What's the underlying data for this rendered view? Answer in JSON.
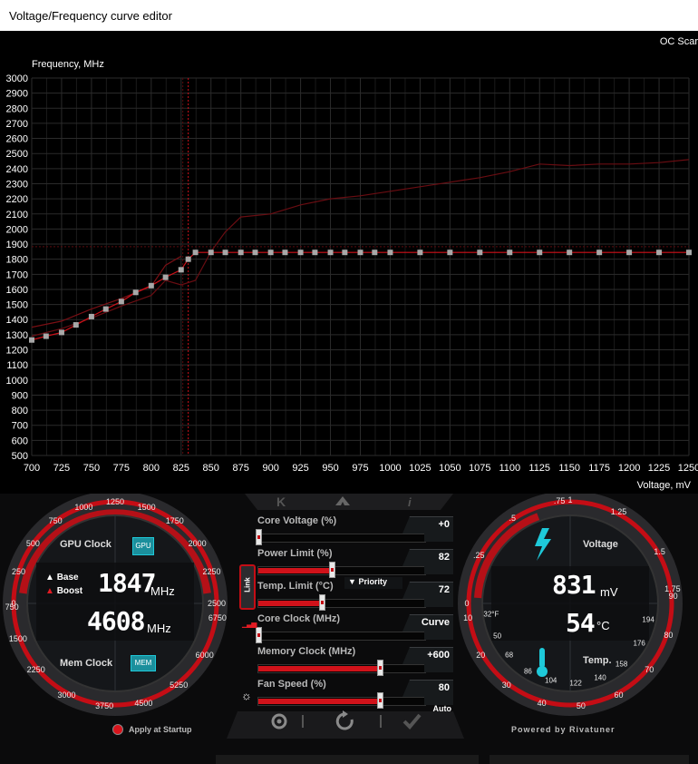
{
  "window": {
    "title": "Voltage/Frequency curve editor",
    "oc_scanner_label": "OC Scar"
  },
  "chart_data": {
    "type": "line",
    "ylabel": "Frequency, MHz",
    "xlabel": "Voltage, mV",
    "xlim": [
      700,
      1250
    ],
    "ylim": [
      500,
      3000
    ],
    "x_ticks": [
      700,
      725,
      750,
      775,
      800,
      825,
      850,
      875,
      900,
      925,
      950,
      975,
      1000,
      1025,
      1050,
      1075,
      1100,
      1125,
      1150,
      1175,
      1200,
      1225,
      1250
    ],
    "y_ticks": [
      500,
      600,
      700,
      800,
      900,
      1000,
      1100,
      1200,
      1300,
      1400,
      1500,
      1600,
      1700,
      1800,
      1900,
      2000,
      2100,
      2200,
      2300,
      2400,
      2500,
      2600,
      2700,
      2800,
      2900,
      3000
    ],
    "current_voltage_marker": 831,
    "frequency_cap": 1847,
    "series": [
      {
        "role": "curve_points",
        "x": [
          700,
          712,
          725,
          737,
          750,
          762,
          775,
          787,
          800,
          812,
          825,
          831,
          837,
          850,
          862,
          875,
          887,
          900,
          912,
          925,
          937,
          950,
          962,
          975,
          987,
          1000,
          1025,
          1050,
          1075,
          1100,
          1125,
          1150,
          1175,
          1200,
          1225,
          1250
        ],
        "y": [
          1265,
          1290,
          1315,
          1365,
          1420,
          1470,
          1520,
          1580,
          1625,
          1680,
          1730,
          1800,
          1845,
          1845,
          1845,
          1845,
          1845,
          1845,
          1845,
          1845,
          1845,
          1845,
          1845,
          1845,
          1845,
          1845,
          1845,
          1845,
          1845,
          1845,
          1845,
          1845,
          1845,
          1845,
          1845,
          1845
        ]
      },
      {
        "role": "default_curve",
        "x": [
          700,
          725,
          750,
          775,
          800,
          812,
          825,
          837,
          850,
          862,
          875,
          900,
          925,
          950,
          975,
          1000,
          1025,
          1050,
          1075,
          1100,
          1125,
          1150,
          1175,
          1200,
          1225,
          1250
        ],
        "y": [
          1290,
          1340,
          1410,
          1490,
          1560,
          1660,
          1630,
          1660,
          1850,
          1980,
          2080,
          2100,
          2160,
          2200,
          2220,
          2250,
          2280,
          2310,
          2340,
          2380,
          2430,
          2420,
          2430,
          2430,
          2440,
          2460
        ]
      },
      {
        "role": "upper_curve",
        "x": [
          700,
          725,
          750,
          775,
          800,
          812,
          825
        ],
        "y": [
          1350,
          1390,
          1470,
          1540,
          1620,
          1760,
          1820
        ]
      }
    ]
  },
  "controls": {
    "core_voltage": {
      "label": "Core Voltage (%)",
      "value": "+0",
      "fraction": 0
    },
    "power_limit": {
      "label": "Power Limit (%)",
      "value": "82",
      "fraction": 0.44
    },
    "temp_limit": {
      "label": "Temp. Limit (°C)",
      "value": "72",
      "fraction": 0.38
    },
    "core_clock": {
      "label": "Core Clock (MHz)",
      "value": "Curve",
      "fraction": 0
    },
    "memory_clock": {
      "label": "Memory Clock (MHz)",
      "value": "+600",
      "fraction": 0.73
    },
    "fan_speed": {
      "label": "Fan Speed (%)",
      "value": "80",
      "fraction": 0.73,
      "mode": "Auto"
    },
    "link_label": "Link",
    "priority_label": "Priority"
  },
  "left_gauge": {
    "gpu_clock_label": "GPU Clock",
    "mem_clock_label": "Mem Clock",
    "gpu_chip": "GPU",
    "mem_chip": "MEM",
    "base_label": "Base",
    "boost_label": "Boost",
    "core_value": "1847",
    "core_unit": "MHz",
    "mem_value": "4608",
    "mem_unit": "MHz",
    "outer_scale": [
      "0",
      "250",
      "500",
      "750",
      "1000",
      "1250",
      "1500",
      "1750",
      "2000",
      "2250",
      "2500"
    ],
    "inner_scale": [
      "750",
      "1500",
      "2250",
      "3000",
      "3750",
      "4500",
      "5250",
      "6000",
      "6750"
    ],
    "apply_at_startup": "Apply at Startup"
  },
  "right_gauge": {
    "voltage_label": "Voltage",
    "temp_label": "Temp.",
    "voltage_value": "831",
    "voltage_unit": "mV",
    "temp_value": "54",
    "temp_unit": "°C",
    "outer_scale": [
      "0",
      ".25",
      ".5",
      ".75",
      "1",
      "1.25",
      "1.5",
      "1.75"
    ],
    "f_scale": [
      "32°F",
      "50",
      "68",
      "86",
      "104",
      "122",
      "140",
      "158",
      "176",
      "194"
    ],
    "c_scale": [
      "10",
      "20",
      "30",
      "40",
      "50",
      "60",
      "70",
      "80",
      "90"
    ],
    "powered_by": "Powered by Rivatuner"
  },
  "colors": {
    "accent": "#cc0a14",
    "grid": "#2a2a2a",
    "cyan": "#1ec9d9",
    "panel": "#0b0b0c"
  }
}
